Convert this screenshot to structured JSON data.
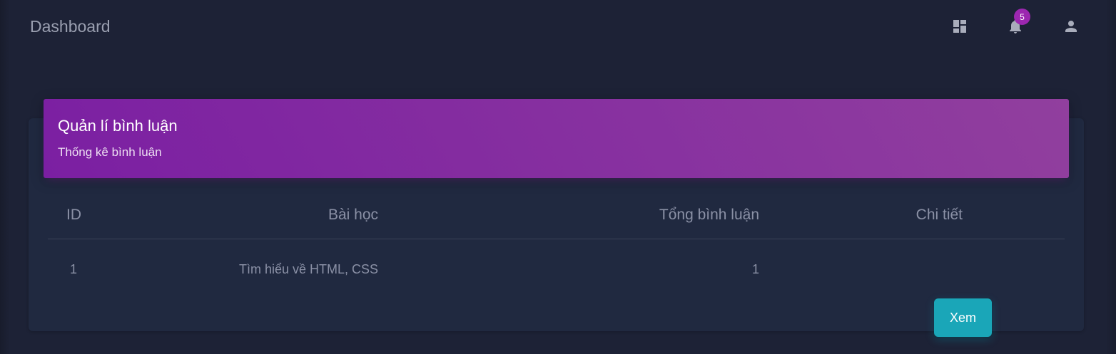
{
  "navbar": {
    "brand": "Dashboard",
    "icons": [
      "dashboard-icon",
      "bell-icon",
      "user-icon"
    ],
    "notification_count": "5"
  },
  "card": {
    "title": "Quản lí bình luận",
    "subtitle": "Thống kê bình luận"
  },
  "table": {
    "headers": [
      "ID",
      "Bài học",
      "Tổng bình luận",
      "Chi tiết"
    ],
    "rows": [
      {
        "id": "1",
        "lesson": "Tìm hiểu về HTML, CSS",
        "total": "1",
        "action": "Xem"
      }
    ]
  },
  "colors": {
    "background": "#1d2236",
    "card": "#202940",
    "header_gradient_start": "#7b1fa2",
    "header_gradient_end": "#913f9e",
    "button": "#1aa6b8",
    "badge": "#9c27b0"
  }
}
